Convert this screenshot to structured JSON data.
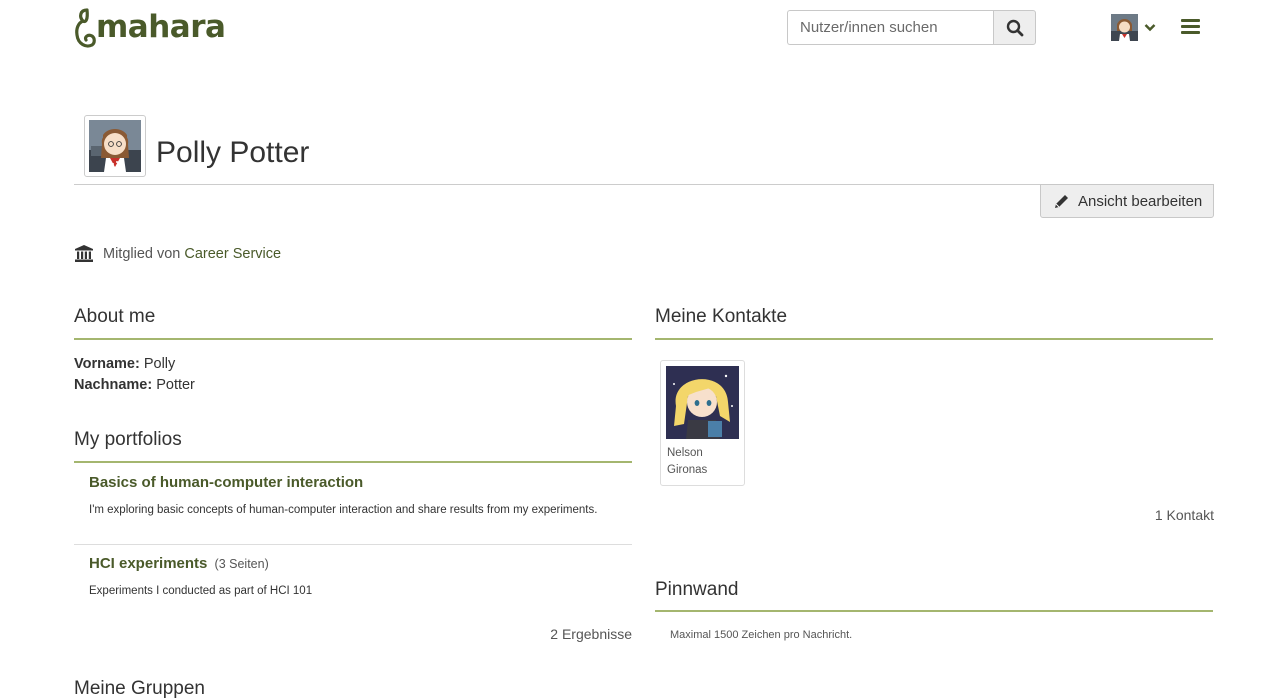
{
  "header": {
    "logo_text": "mahara",
    "search": {
      "placeholder": "Nutzer/innen suchen",
      "value": ""
    },
    "icons": [
      "search-icon",
      "user-avatar",
      "chevron-down-icon",
      "hamburger-menu-icon"
    ]
  },
  "profile": {
    "name": "Polly Potter",
    "edit_button": "Ansicht bearbeiten",
    "member_label": "Mitglied von",
    "institution": "Career Service"
  },
  "about": {
    "title": "About me",
    "fields": [
      {
        "label": "Vorname:",
        "value": "Polly"
      },
      {
        "label": "Nachname:",
        "value": "Potter"
      }
    ]
  },
  "portfolios": {
    "title": "My portfolios",
    "items": [
      {
        "title": "Basics of human-computer interaction",
        "count": "",
        "description": "I'm exploring basic concepts of human-computer interaction and share results from my experiments."
      },
      {
        "title": "HCI experiments",
        "count": "(3 Seiten)",
        "description": "Experiments I conducted as part of HCI 101"
      }
    ],
    "results": "2 Ergebnisse"
  },
  "contacts": {
    "title": "Meine Kontakte",
    "items": [
      {
        "first": "Nelson",
        "last": "Gironas"
      }
    ],
    "count": "1 Kontakt"
  },
  "wall": {
    "title": "Pinnwand",
    "note": "Maximal 1500 Zeichen pro Nachricht."
  },
  "groups": {
    "title": "Meine Gruppen"
  },
  "colors": {
    "brand": "#4a5a2a",
    "accent_rule": "#a4b66f"
  }
}
